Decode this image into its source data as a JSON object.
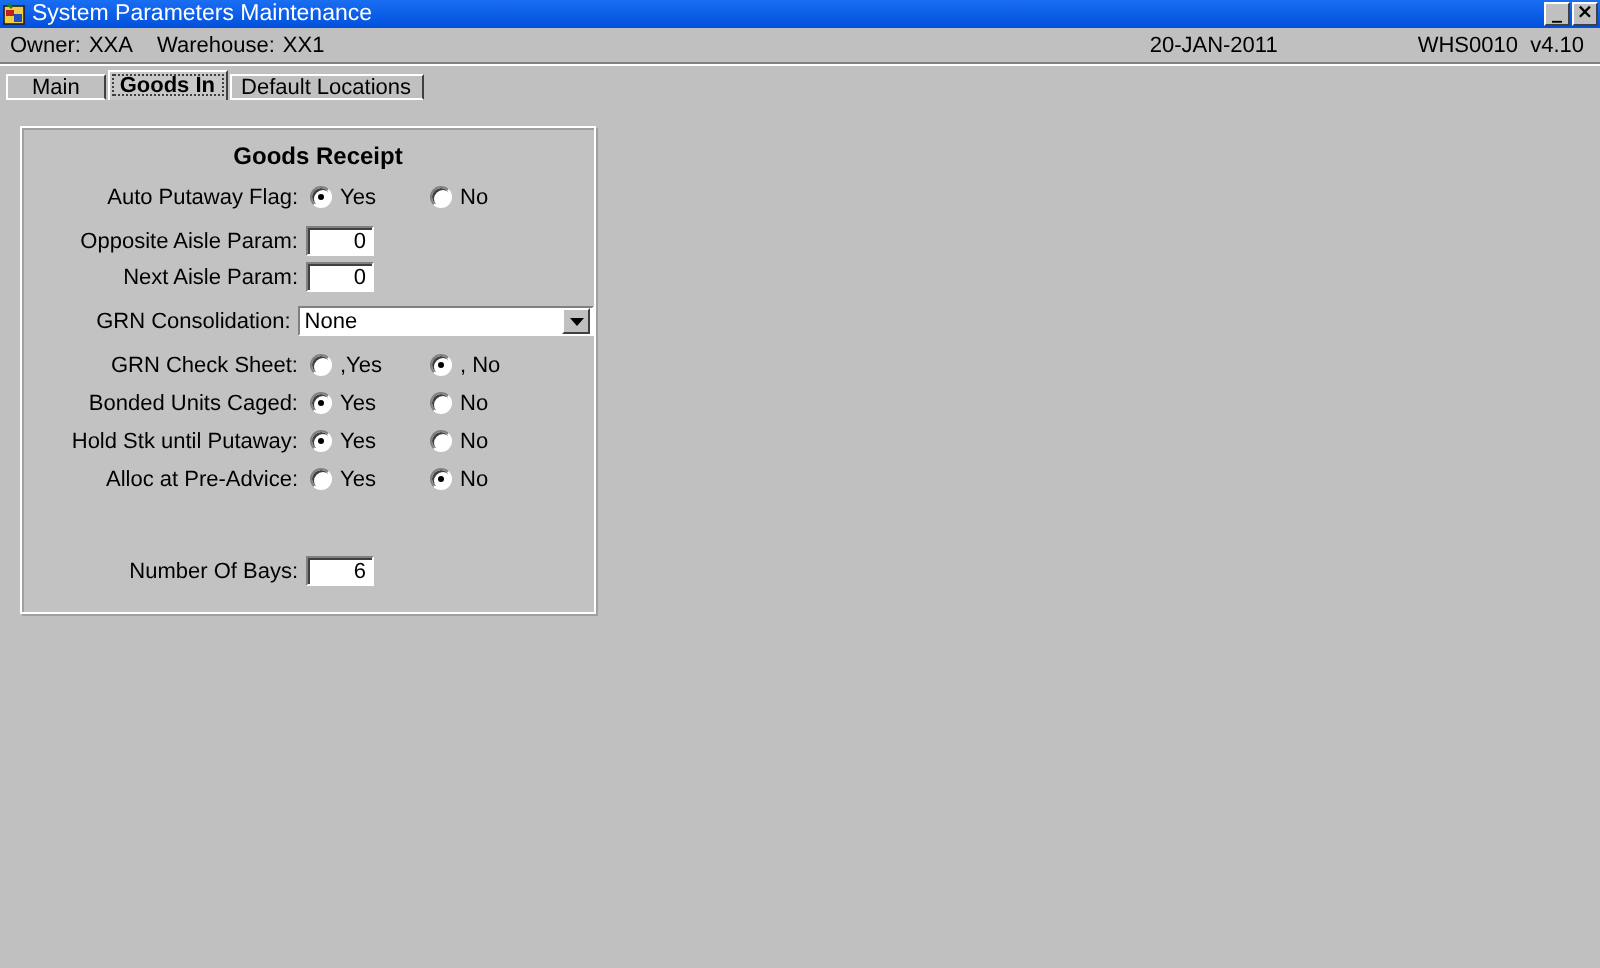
{
  "window": {
    "title": "System Parameters Maintenance",
    "controls": [
      "_",
      "×"
    ]
  },
  "info_bar": {
    "owner_label": "Owner:",
    "owner": "XXA",
    "warehouse_label": "Warehouse:",
    "warehouse": "XX1",
    "date": "20-JAN-2011",
    "version": "WHS0010  v4.10"
  },
  "tabs": [
    {
      "label": "Main",
      "selected": false
    },
    {
      "label": "Goods In",
      "selected": true
    },
    {
      "label": "Default Locations",
      "selected": false
    }
  ],
  "panel": {
    "title": "Goods Receipt",
    "groups": [
      {
        "rows": [
          {
            "kind": "radio",
            "label": "Auto Putaway Flag:",
            "options": [
              {
                "label": "Yes",
                "selected": true
              },
              {
                "label": "No",
                "selected": false
              }
            ]
          }
        ]
      },
      {
        "rows": [
          {
            "kind": "number",
            "label": "Opposite Aisle Param:",
            "value": "0"
          },
          {
            "kind": "number",
            "label": "Next Aisle Param:",
            "value": "0"
          }
        ]
      },
      {
        "rows": [
          {
            "kind": "combo",
            "label": "GRN Consolidation:",
            "value": "None"
          }
        ]
      },
      {
        "rows": [
          {
            "kind": "radio",
            "label": "GRN Check Sheet:",
            "options": [
              {
                "label": ",Yes",
                "selected": false
              },
              {
                "label": ", No",
                "selected": true
              }
            ]
          },
          {
            "kind": "radio",
            "label": "Bonded Units Caged:",
            "options": [
              {
                "label": "Yes",
                "selected": true
              },
              {
                "label": "No",
                "selected": false
              }
            ]
          },
          {
            "kind": "radio",
            "label": "Hold Stk until Putaway:",
            "options": [
              {
                "label": "Yes",
                "selected": true
              },
              {
                "label": "No",
                "selected": false
              }
            ]
          },
          {
            "kind": "radio",
            "label": "Alloc at Pre-Advice:",
            "options": [
              {
                "label": "Yes",
                "selected": false
              },
              {
                "label": "No",
                "selected": true
              }
            ]
          }
        ]
      },
      {
        "rows": [
          {
            "kind": "number",
            "label": "Number Of Bays:",
            "value": "6"
          }
        ]
      }
    ]
  }
}
